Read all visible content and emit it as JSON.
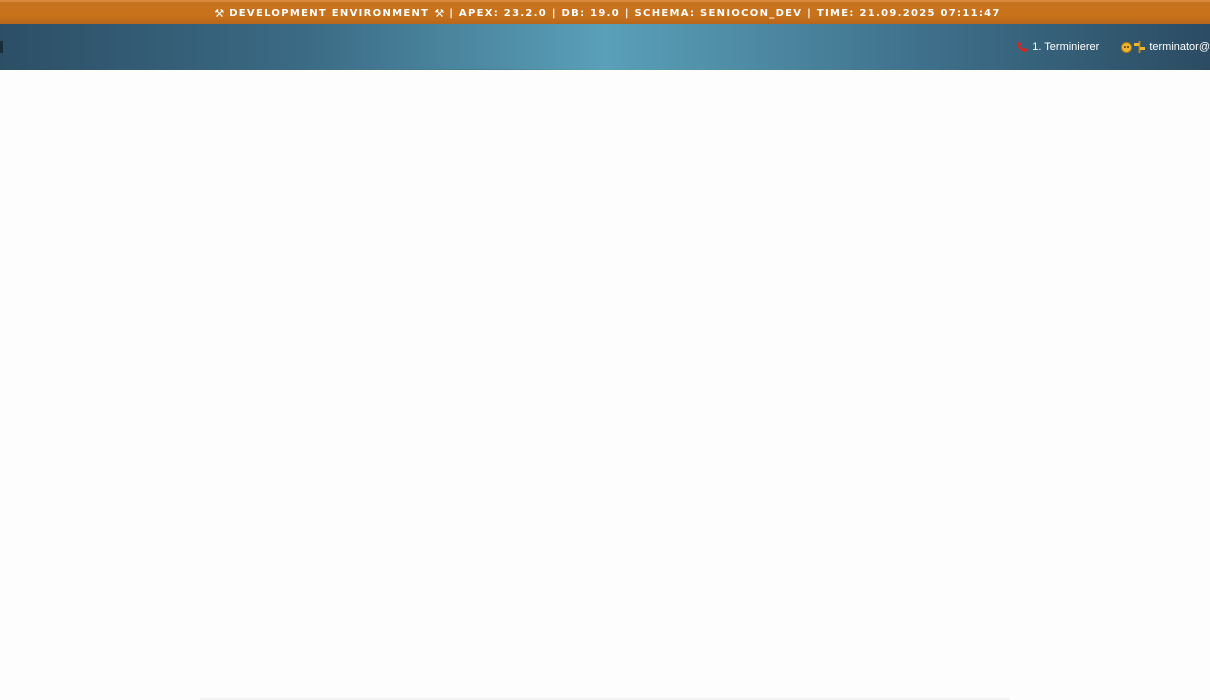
{
  "env_banner": {
    "text": "DEVELOPMENT ENVIRONMENT",
    "details": "| APEX: 23.2.0 | DB: 19.0 | SCHEMA: SENIOCON_DEV | TIME: 21.09.2025 07:11:47",
    "icon_left": "tools-icon",
    "icon_right": "tools-icon",
    "background_color": "#c8721c"
  },
  "header": {
    "gradient_colors": [
      "#2c4f66",
      "#5aa0b8",
      "#2b4c63"
    ],
    "nav": {
      "phone_label": "1. Terminierer",
      "phone_icon": "phone-icon",
      "user_label": "terminator@",
      "user_icons": [
        "face-icon",
        "sign-icon"
      ]
    }
  },
  "main": {
    "background_color": "#fdfdfd"
  }
}
